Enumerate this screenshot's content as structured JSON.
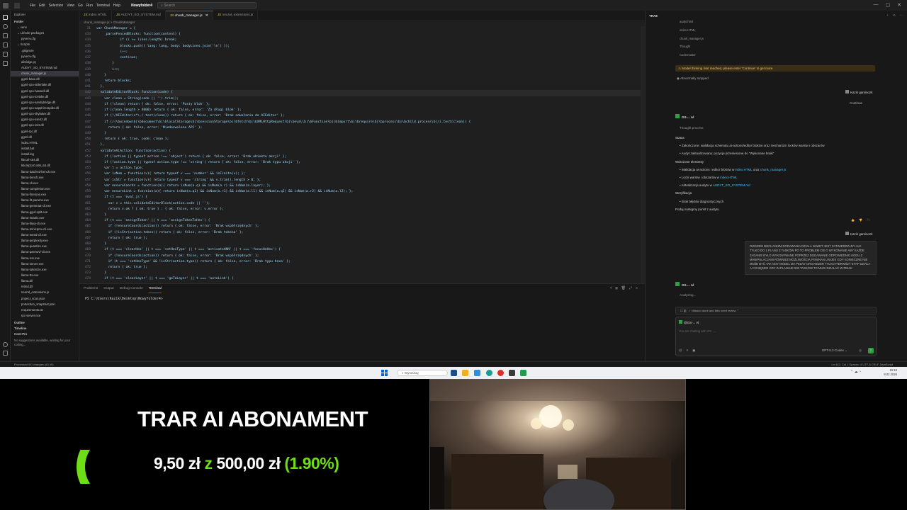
{
  "titlebar": {
    "menu": [
      "File",
      "Edit",
      "Selection",
      "View",
      "Go",
      "Run",
      "Terminal",
      "Help"
    ],
    "project": "Nowyfolder4",
    "search_placeholder": "Search"
  },
  "explorer": {
    "header": "Explorer",
    "folder_label": "Folder",
    "items": [
      {
        "label": "venv",
        "type": "folder"
      },
      {
        "label": "Lib\\site-packages",
        "type": "folder"
      },
      {
        "label": "pyvenv.cfg",
        "type": "file"
      },
      {
        "label": "Scripts",
        "type": "folder"
      },
      {
        "label": ".gitignore",
        "type": "file"
      },
      {
        "label": "pyvenv.cfg",
        "type": "file"
      },
      {
        "label": "aibridge.py",
        "type": "file"
      },
      {
        "label": "AUDYT_SO_SYSTEM.md",
        "type": "file"
      },
      {
        "label": "chunk_manager.js",
        "type": "file",
        "selected": true
      },
      {
        "label": "ggml-base.dll",
        "type": "file"
      },
      {
        "label": "ggml-cpu-alderlake.dll",
        "type": "file"
      },
      {
        "label": "ggml-cpu-haswell.dll",
        "type": "file"
      },
      {
        "label": "ggml-cpu-icelake.dll",
        "type": "file"
      },
      {
        "label": "ggml-cpu-sandybridge.dll",
        "type": "file"
      },
      {
        "label": "ggml-cpu-sapphirerapids.dll",
        "type": "file"
      },
      {
        "label": "ggml-cpu-skylakex.dll",
        "type": "file"
      },
      {
        "label": "ggml-cpu-sse42.dll",
        "type": "file"
      },
      {
        "label": "ggml-cpu-x64.dll",
        "type": "file"
      },
      {
        "label": "ggml-rpc.dll",
        "type": "file"
      },
      {
        "label": "ggml.dll",
        "type": "file"
      },
      {
        "label": "index.HTML",
        "type": "file"
      },
      {
        "label": "install.bat",
        "type": "file"
      },
      {
        "label": "install.log",
        "type": "file"
      },
      {
        "label": "libcurl-x64.dll",
        "type": "file"
      },
      {
        "label": "libomp140.x86_64.dll",
        "type": "file"
      },
      {
        "label": "llama-batched-bench.exe",
        "type": "file"
      },
      {
        "label": "llama-bench.exe",
        "type": "file"
      },
      {
        "label": "llama-cli.exe",
        "type": "file"
      },
      {
        "label": "llama-completion.exe",
        "type": "file"
      },
      {
        "label": "llama-finetune.exe",
        "type": "file"
      },
      {
        "label": "llama-fit-params.exe",
        "type": "file"
      },
      {
        "label": "llama-gemma3-cli.exe",
        "type": "file"
      },
      {
        "label": "llama-gguf-split.exe",
        "type": "file"
      },
      {
        "label": "llama-imatrix.exe",
        "type": "file"
      },
      {
        "label": "llama-llava-cli.exe",
        "type": "file"
      },
      {
        "label": "llama-minicpmv-cli.exe",
        "type": "file"
      },
      {
        "label": "llama-mtmd-cli.exe",
        "type": "file"
      },
      {
        "label": "llama-perplexity.exe",
        "type": "file"
      },
      {
        "label": "llama-quantize.exe",
        "type": "file"
      },
      {
        "label": "llama-qwen2vl-cli.exe",
        "type": "file"
      },
      {
        "label": "llama-run.exe",
        "type": "file"
      },
      {
        "label": "llama-server.exe",
        "type": "file"
      },
      {
        "label": "llama-tokenize.exe",
        "type": "file"
      },
      {
        "label": "llama-tts.exe",
        "type": "file"
      },
      {
        "label": "llama.dll",
        "type": "file"
      },
      {
        "label": "mtmd.dll",
        "type": "file"
      },
      {
        "label": "neural_extensions.js",
        "type": "file"
      },
      {
        "label": "project_scan.json",
        "type": "file"
      },
      {
        "label": "protection_snapshot.json",
        "type": "file"
      },
      {
        "label": "requirements.txt",
        "type": "file"
      },
      {
        "label": "rpc-server.exe",
        "type": "file"
      }
    ],
    "outline": "Outline",
    "timeline": "Timeline",
    "cont_pro": "Cont-Pro",
    "cont_note": "No suggestions available, waiting for your coding..."
  },
  "editor": {
    "tabs": [
      {
        "label": "index.HTML",
        "active": false
      },
      {
        "label": "AUDYT_SO_SYSTEM.md",
        "active": false
      },
      {
        "label": "chunk_manager.js",
        "active": true
      },
      {
        "label": "neural_extensions.js",
        "active": false
      }
    ],
    "breadcrumb": "chunk_manager.js > ChunkManager",
    "lines": [
      {
        "n": "31",
        "t": "var ChunkManager = {"
      },
      {
        "n": "433",
        "t": "    _parseFencedBlocks: function(content) {"
      },
      {
        "n": "434",
        "t": "            if (i >= lines.length) break;"
      },
      {
        "n": "435",
        "t": "            blocks.push({ lang: lang, body: bodyLines.join('\\n') });"
      },
      {
        "n": "436",
        "t": "            i++;"
      },
      {
        "n": "437",
        "t": "            continue;"
      },
      {
        "n": "438",
        "t": "        }"
      },
      {
        "n": "439",
        "t": "        i++;"
      },
      {
        "n": "440",
        "t": "    }"
      },
      {
        "n": "441",
        "t": "    return blocks;"
      },
      {
        "n": "441",
        "t": "  },"
      },
      {
        "n": "442",
        "t": "  validateEditorBlock: function(code) {",
        "hl": true
      },
      {
        "n": "443",
        "t": "    var clean = String(code || '').trim();"
      },
      {
        "n": "444",
        "t": "    if (!clean) return { ok: false, error: 'Pusty blok' };"
      },
      {
        "n": "445",
        "t": "    if (clean.length > 4000) return { ok: false, error: 'Za długi blok' };"
      },
      {
        "n": "446",
        "t": "    if (!/AIEditor\\s*\\./.test(clean)) return { ok: false, error: 'Brak odwołania do AIEditor' };"
      },
      {
        "n": "447",
        "t": "    if (/(\\bwindow\\b|\\bdocument\\b|\\blocalStorage\\b|\\bsessionStorage\\b|\\bfetch\\b|\\bXMLHttpRequest\\b|\\beval\\b|\\bFunction\\b|\\bimport\\b|\\brequire\\b|\\bprocess\\b|\\bchild_process\\b)/i.test(clean)) {"
      },
      {
        "n": "448",
        "t": "      return { ok: false, error: 'Niedozwolone API' };"
      },
      {
        "n": "449",
        "t": "    }"
      },
      {
        "n": "450",
        "t": "    return { ok: true, code: clean };"
      },
      {
        "n": "451",
        "t": "  },"
      },
      {
        "n": "452",
        "t": "  validateAiAction: function(action) {"
      },
      {
        "n": "453",
        "t": "    if (!action || typeof action !== 'object') return { ok: false, error: 'Brak obiektu akcji' };"
      },
      {
        "n": "454",
        "t": "    if (!action.type || typeof action.type !== 'string') return { ok: false, error: 'Brak typu akcji' };"
      },
      {
        "n": "455",
        "t": "    var t = action.type;"
      },
      {
        "n": "456",
        "t": "    var isNum = function(v){ return typeof v === 'number' && isFinite(v); };"
      },
      {
        "n": "457",
        "t": "    var isStr = function(v){ return typeof v === 'string' && v.trim().length > 0; };"
      },
      {
        "n": "458",
        "t": "    var ensureCoords = function(a){ return isNum(a.q) && isNum(a.r) && isNum(a.layer); };"
      },
      {
        "n": "459",
        "t": "    var ensureLink = function(a){ return isNum(a.q1) && isNum(a.r1) && isNum(a.l1) && isNum(a.q2) && isNum(a.r2) && isNum(a.l2); };"
      },
      {
        "n": "460",
        "t": "    if (t === 'eval_js') {"
      },
      {
        "n": "461",
        "t": "      var v = this.validateEditorBlock(action.code || '');"
      },
      {
        "n": "462",
        "t": "      return v.ok ? { ok: true } : { ok: false, error: v.error };"
      },
      {
        "n": "463",
        "t": "    }"
      },
      {
        "n": "464",
        "t": "    if (t === 'assignToken' || t === 'assignTokenToHex') {"
      },
      {
        "n": "465",
        "t": "      if (!ensureCoords(action)) return { ok: false, error: 'Brak współrzędnych' };"
      },
      {
        "n": "466",
        "t": "      if (!isStr(action.token)) return { ok: false, error: 'Brak tokena' };"
      },
      {
        "n": "467",
        "t": "      return { ok: true };"
      },
      {
        "n": "468",
        "t": "    }"
      },
      {
        "n": "469",
        "t": "    if (t === 'clearHex' || t === 'setHexType' || t === 'activateANN' || t === 'focusOnHex') {"
      },
      {
        "n": "470",
        "t": "      if (!ensureCoords(action)) return { ok: false, error: 'Brak współrzędnych' };"
      },
      {
        "n": "471",
        "t": "      if (t === 'setHexType' && !isStr(action.type)) return { ok: false, error: 'Brak typu hexa' };"
      },
      {
        "n": "472",
        "t": "      return { ok: true };"
      },
      {
        "n": "473",
        "t": "    }"
      },
      {
        "n": "474",
        "t": "    if (t === 'clearLayer' || t === 'goToLayer' || t === 'autoLink') {"
      }
    ]
  },
  "panel": {
    "tabs": [
      "Problems",
      "Output",
      "Debug Console",
      "Terminal"
    ],
    "active": "Terminal",
    "prompt": "PS C:\\Users\\Kazik\\Desktop\\Nowyfolder4>"
  },
  "chat": {
    "header": "TRAE",
    "history": [
      "audyt.html",
      "index.HTML",
      "chunk_manager.js",
      "Thought",
      "Codemaster"
    ],
    "warning": "Model thinking limit reached, please enter 'Continue' to get more.",
    "stopped": "Abnormally stopped",
    "user_name": "Kazik gaminozk",
    "continue_label": "Continue",
    "agent_name": "GS-... Al",
    "thought": "Thought process",
    "status_h": "Status",
    "status_items": [
      "Zakończone: walidacja schematu ai-actions/editor bloków oraz mechanizm locków warstw i obszarów",
      "Audyt zaktualizowany: pozycje przeniesione do \"Wykonane braki\""
    ],
    "done_h": "Wdrożone elementy",
    "done_items": [
      {
        "pre": "Walidacja ai-actions i editor bloków w",
        "f1": "index.HTML",
        "mid": "oraz",
        "f2": "chunk_manager.js"
      },
      {
        "pre": "Locki warstw i obszarów w",
        "f1": "index.HTML",
        "mid": "",
        "f2": ""
      },
      {
        "pre": "Aktualizacja audytu w",
        "f1": "AUDYT_SO_SYSTEM.md",
        "mid": "",
        "f2": ""
      }
    ],
    "verify_h": "Weryfikacja",
    "verify_items": [
      "Brak błędów diagnostycznych"
    ],
    "next": "Podaj następny punkt z audytu.",
    "user_msg": "OWSZEM MECHANIZM DODAWANIA DZIAŁA NAWET JEST ZATWIERDZANY ALE TYLKO DO 1 PLANU Z TASKÓW PO TO PROBLEM CIE O WYKONANIE ABY KAŻDE ZADANIE BYŁO WYKONYWANE POPRZEZ DODAWANIE ODPOWIEDNIO KODU Z MANIPULACJAMI RÓWNIEŻ MOŻLIWOŚCIĄ POWNAN LINIJEK GDY KONIECZNE NIE MOŻE BYĆ TAK GDY MODEL MA PEŁNY ORGANIZER TYLKO PIERWSZY ETAP DZIAŁA A CO BĘDZIE GDY ZAPLANUJE 500 TASKÓW TO MUSI DZIAŁAĆ W PEŁNI",
    "analyzing": "Analyzing...",
    "todo_label": "Mission done and files need review",
    "input_agent": "@GS-... Al",
    "input_placeholder": "You are chatting with GS - ...",
    "model": "GPT-5.2-Codex"
  },
  "statusbar": {
    "left": "Processed 0/0 changes (#0 #0)",
    "right": "Ln 442, Col 1   Spaces: 4   UTF-8   CRLF   JavaScript"
  },
  "taskbar": {
    "search": "Wyszukaj",
    "time": "19:16",
    "date": "8.02.2026"
  },
  "overlay": {
    "title": "TRAR AI ABONAMENT",
    "current": "9,50 zł",
    "sep": "z",
    "target": "500,00 zł",
    "percent_text": "(1.90%)",
    "percent": 1.9,
    "accent": "#6ede16"
  }
}
